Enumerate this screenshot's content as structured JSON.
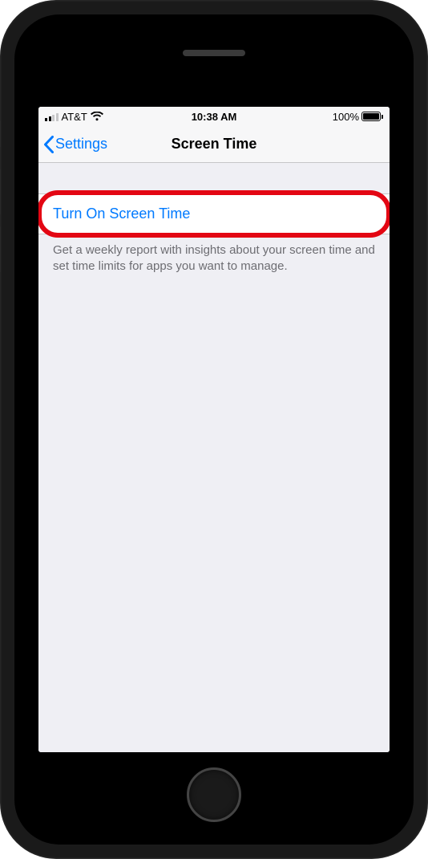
{
  "status_bar": {
    "carrier": "AT&T",
    "time": "10:38 AM",
    "battery_percent": "100%"
  },
  "nav": {
    "back_label": "Settings",
    "title": "Screen Time"
  },
  "main": {
    "turn_on_label": "Turn On Screen Time",
    "description": "Get a weekly report with insights about your screen time and set time limits for apps you want to manage."
  }
}
